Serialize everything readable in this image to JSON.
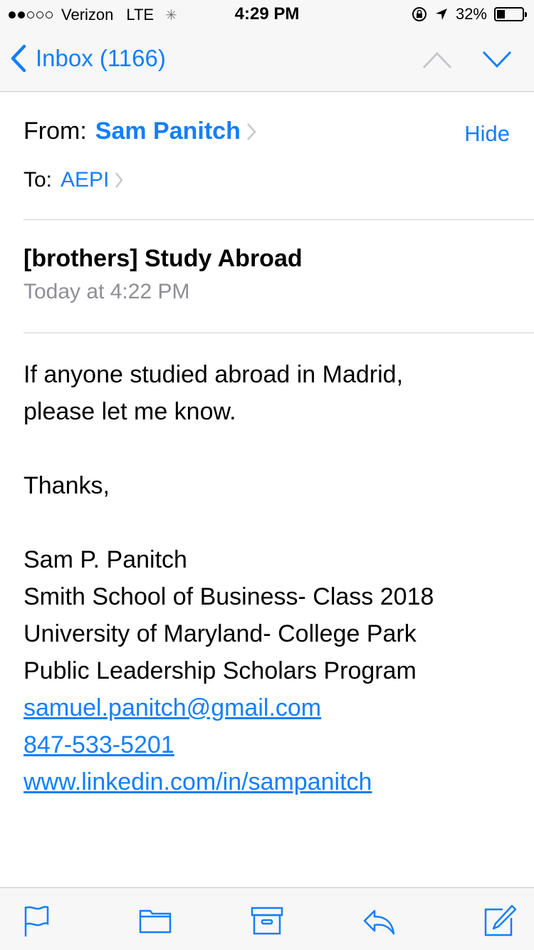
{
  "status_bar": {
    "carrier": "Verizon",
    "network": "LTE",
    "time": "4:29 PM",
    "battery_percent": "32%",
    "battery_level": 0.32,
    "signal_bars": 2
  },
  "nav": {
    "back_label": "Inbox (1166)",
    "up_icon": "chevron-up-icon",
    "down_icon": "chevron-down-icon"
  },
  "header": {
    "from_label": "From:",
    "from_name": "Sam Panitch",
    "to_label": "To:",
    "to_name": "AEPI",
    "hide_label": "Hide",
    "subject": "[brothers] Study Abroad",
    "date": "Today at 4:22 PM"
  },
  "body": {
    "line1": "If anyone studied abroad in Madrid,",
    "line2": "please let me know.",
    "thanks": "Thanks,",
    "sig_name": "Sam P. Panitch",
    "sig_school": "Smith School of Business- Class 2018",
    "sig_university": "University of Maryland- College Park",
    "sig_program": "Public Leadership Scholars Program",
    "email": "samuel.panitch@gmail.com",
    "phone": "847-533-5201",
    "linkedin": "www.linkedin.com/in/sampanitch"
  },
  "toolbar": {
    "icons": [
      "flag-icon",
      "folder-icon",
      "archive-icon",
      "reply-icon",
      "compose-icon"
    ]
  },
  "colors": {
    "accent": "#147efb",
    "secondary_text": "#8e8e93"
  }
}
